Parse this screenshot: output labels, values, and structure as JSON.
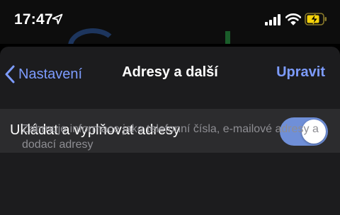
{
  "status_bar": {
    "time": "17:47",
    "icons": [
      "location-arrow-icon",
      "cellular-signal-icon",
      "wifi-icon",
      "battery-charging-icon"
    ],
    "battery_color": "#f5d20b"
  },
  "nav": {
    "back_label": "Nastavení",
    "title": "Adresy a další",
    "edit_label": "Upravit"
  },
  "settings": {
    "autofill_label": "Ukládat a vyplňovat adresy",
    "autofill_enabled": true,
    "footer_note": "Zahrnuje informace jako telefonní čísla, e-mailové adresy a dodací adresy"
  },
  "colors": {
    "accent": "#7d9cff",
    "toggle_on": "#6f8fd8",
    "row_background": "#2c2c2e",
    "sheet_background": "#1c1c1e",
    "secondary_text": "#8e8e93"
  }
}
